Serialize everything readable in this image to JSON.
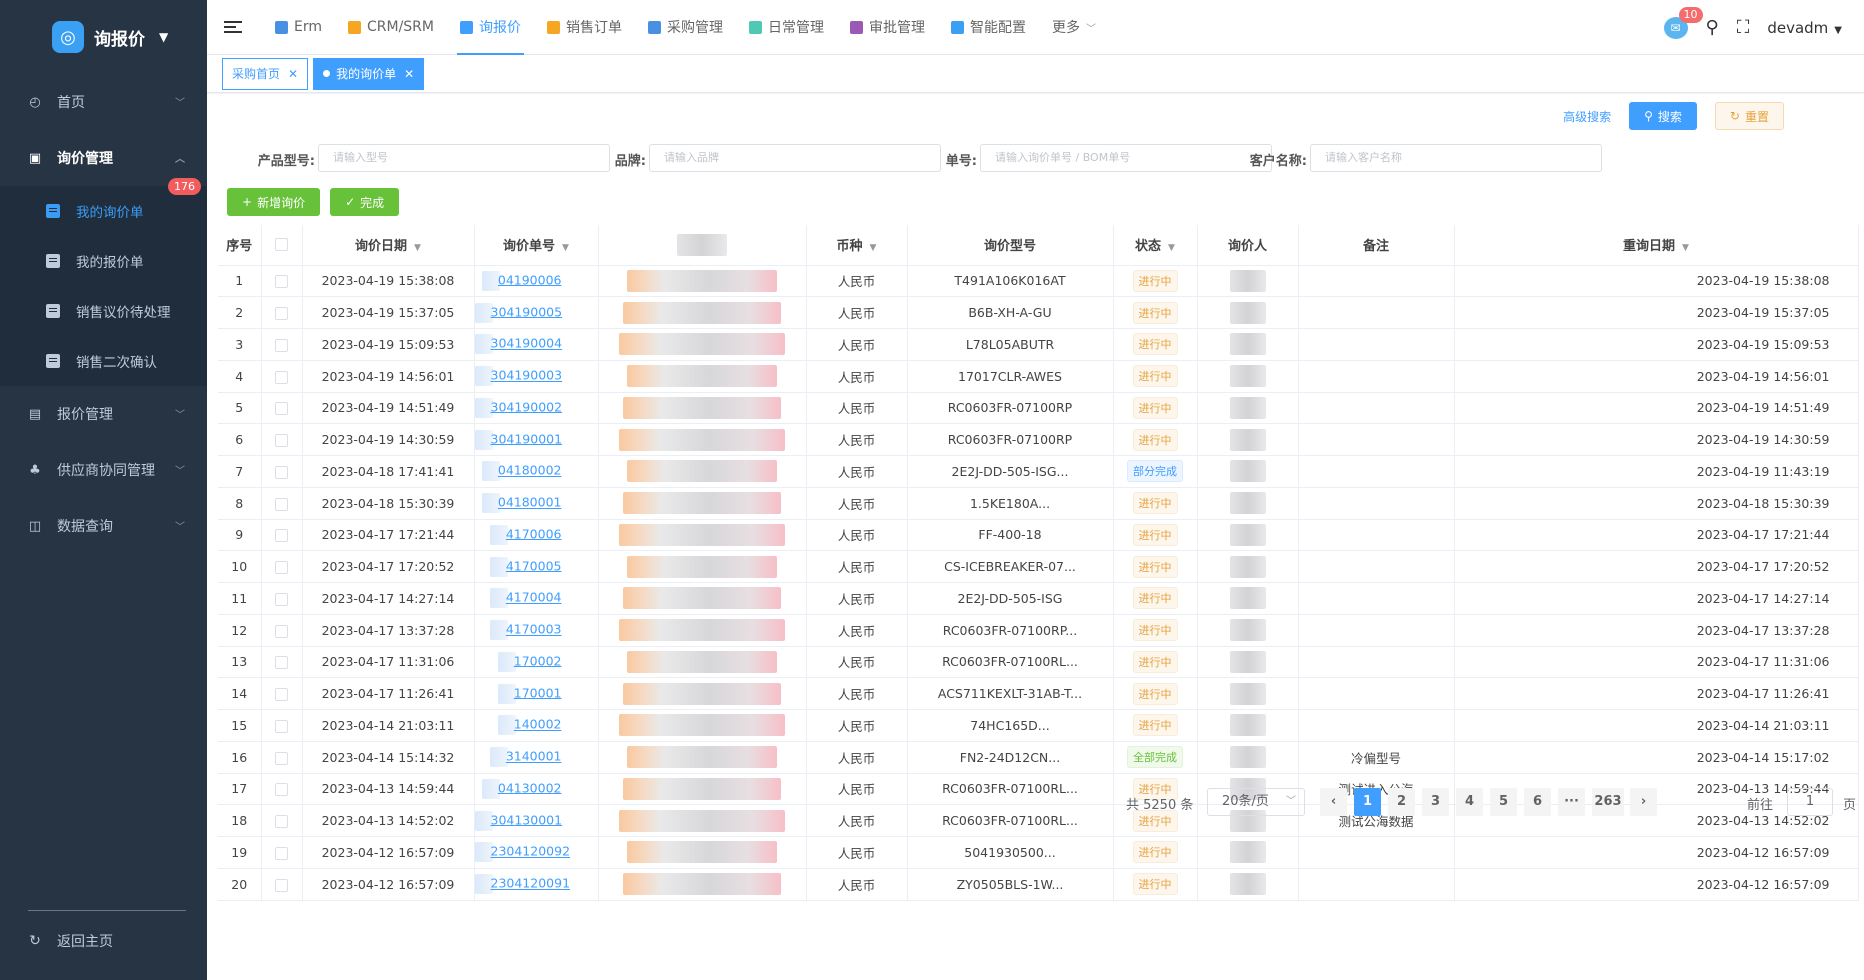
{
  "app": {
    "name": "询报价"
  },
  "sidebar": {
    "items": [
      {
        "label": "首页"
      },
      {
        "label": "询价管理"
      },
      {
        "label": "报价管理"
      },
      {
        "label": "供应商协同管理"
      },
      {
        "label": "数据查询"
      }
    ],
    "sub_items": [
      {
        "label": "我的询价单",
        "badge": "176"
      },
      {
        "label": "我的报价单"
      },
      {
        "label": "销售议价待处理"
      },
      {
        "label": "销售二次确认"
      }
    ],
    "back_home": "返回主页"
  },
  "topnav": {
    "tabs": [
      {
        "label": "Erm",
        "color": "#4a90e2"
      },
      {
        "label": "CRM/SRM",
        "color": "#f5a623"
      },
      {
        "label": "询报价",
        "color": "#409eff"
      },
      {
        "label": "销售订单",
        "color": "#f5a623"
      },
      {
        "label": "采购管理",
        "color": "#4a90e2"
      },
      {
        "label": "日常管理",
        "color": "#50c8b4"
      },
      {
        "label": "审批管理",
        "color": "#9b59b6"
      },
      {
        "label": "智能配置",
        "color": "#3aa0f3"
      }
    ],
    "more": "更多",
    "message_count": "10",
    "user": "devadm"
  },
  "page_tabs": [
    {
      "label": "采购首页"
    },
    {
      "label": "我的询价单"
    }
  ],
  "toolbar": {
    "advanced_search": "高级搜索",
    "search": "搜索",
    "reset": "重置",
    "add": "新增询价",
    "complete": "完成"
  },
  "filters": [
    {
      "label": "产品型号:",
      "placeholder": "请输入型号"
    },
    {
      "label": "品牌:",
      "placeholder": "请输入品牌"
    },
    {
      "label": "单号:",
      "placeholder": "请输入询价单号 / BOM单号"
    },
    {
      "label": "客户名称:",
      "placeholder": "请输入客户名称"
    }
  ],
  "table": {
    "headers": [
      "序号",
      "",
      "询价日期",
      "询价单号",
      "",
      "币种",
      "询价型号",
      "状态",
      "询价人",
      "备注",
      "重询日期"
    ],
    "rows": [
      {
        "no": "1",
        "date": "2023-04-19 15:38:08",
        "order": "04190006",
        "currency": "人民币",
        "model": "T491A106K016AT",
        "status": "进行中",
        "note": "",
        "redate": "2023-04-19 15:38:08"
      },
      {
        "no": "2",
        "date": "2023-04-19 15:37:05",
        "order": "304190005",
        "currency": "人民币",
        "model": "B6B-XH-A-GU",
        "status": "进行中",
        "note": "",
        "redate": "2023-04-19 15:37:05"
      },
      {
        "no": "3",
        "date": "2023-04-19 15:09:53",
        "order": "304190004",
        "currency": "人民币",
        "model": "L78L05ABUTR",
        "status": "进行中",
        "note": "",
        "redate": "2023-04-19 15:09:53"
      },
      {
        "no": "4",
        "date": "2023-04-19 14:56:01",
        "order": "304190003",
        "currency": "人民币",
        "model": "17017CLR-AWES",
        "status": "进行中",
        "note": "",
        "redate": "2023-04-19 14:56:01"
      },
      {
        "no": "5",
        "date": "2023-04-19 14:51:49",
        "order": "304190002",
        "currency": "人民币",
        "model": "RC0603FR-07100RP",
        "status": "进行中",
        "note": "",
        "redate": "2023-04-19 14:51:49"
      },
      {
        "no": "6",
        "date": "2023-04-19 14:30:59",
        "order": "304190001",
        "currency": "人民币",
        "model": "RC0603FR-07100RP",
        "status": "进行中",
        "note": "",
        "redate": "2023-04-19 14:30:59"
      },
      {
        "no": "7",
        "date": "2023-04-18 17:41:41",
        "order": "04180002",
        "currency": "人民币",
        "model": "2E2J-DD-505-ISG...",
        "status": "部分完成",
        "note": "",
        "redate": "2023-04-19 11:43:19"
      },
      {
        "no": "8",
        "date": "2023-04-18 15:30:39",
        "order": "04180001",
        "currency": "人民币",
        "model": "1.5KE180A...",
        "status": "进行中",
        "note": "",
        "redate": "2023-04-18 15:30:39"
      },
      {
        "no": "9",
        "date": "2023-04-17 17:21:44",
        "order": "4170006",
        "currency": "人民币",
        "model": "FF-400-18",
        "status": "进行中",
        "note": "",
        "redate": "2023-04-17 17:21:44"
      },
      {
        "no": "10",
        "date": "2023-04-17 17:20:52",
        "order": "4170005",
        "currency": "人民币",
        "model": "CS-ICEBREAKER-07...",
        "status": "进行中",
        "note": "",
        "redate": "2023-04-17 17:20:52"
      },
      {
        "no": "11",
        "date": "2023-04-17 14:27:14",
        "order": "4170004",
        "currency": "人民币",
        "model": "2E2J-DD-505-ISG",
        "status": "进行中",
        "note": "",
        "redate": "2023-04-17 14:27:14"
      },
      {
        "no": "12",
        "date": "2023-04-17 13:37:28",
        "order": "4170003",
        "currency": "人民币",
        "model": "RC0603FR-07100RP...",
        "status": "进行中",
        "note": "",
        "redate": "2023-04-17 13:37:28"
      },
      {
        "no": "13",
        "date": "2023-04-17 11:31:06",
        "order": "170002",
        "currency": "人民币",
        "model": "RC0603FR-07100RL...",
        "status": "进行中",
        "note": "",
        "redate": "2023-04-17 11:31:06"
      },
      {
        "no": "14",
        "date": "2023-04-17 11:26:41",
        "order": "170001",
        "currency": "人民币",
        "model": "ACS711KEXLT-31AB-T...",
        "status": "进行中",
        "note": "",
        "redate": "2023-04-17 11:26:41"
      },
      {
        "no": "15",
        "date": "2023-04-14 21:03:11",
        "order": "140002",
        "currency": "人民币",
        "model": "74HC165D...",
        "status": "进行中",
        "note": "",
        "redate": "2023-04-14 21:03:11"
      },
      {
        "no": "16",
        "date": "2023-04-14 15:14:32",
        "order": "3140001",
        "currency": "人民币",
        "model": "FN2-24D12CN...",
        "status": "全部完成",
        "note": "冷偏型号",
        "redate": "2023-04-14 15:17:02"
      },
      {
        "no": "17",
        "date": "2023-04-13 14:59:44",
        "order": "04130002",
        "currency": "人民币",
        "model": "RC0603FR-07100RL...",
        "status": "进行中",
        "note": "测试进入公海",
        "redate": "2023-04-13 14:59:44"
      },
      {
        "no": "18",
        "date": "2023-04-13 14:52:02",
        "order": "304130001",
        "currency": "人民币",
        "model": "RC0603FR-07100RL...",
        "status": "进行中",
        "note": "测试公海数据",
        "redate": "2023-04-13 14:52:02"
      },
      {
        "no": "19",
        "date": "2023-04-12 16:57:09",
        "order": "2304120092",
        "currency": "人民币",
        "model": "5041930500...",
        "status": "进行中",
        "note": "",
        "redate": "2023-04-12 16:57:09"
      },
      {
        "no": "20",
        "date": "2023-04-12 16:57:09",
        "order": "2304120091",
        "currency": "人民币",
        "model": "ZY0505BLS-1W...",
        "status": "进行中",
        "note": "",
        "redate": "2023-04-12 16:57:09"
      }
    ]
  },
  "pagination": {
    "total": "共 5250 条",
    "page_size": "20条/页",
    "pages": [
      "1",
      "2",
      "3",
      "4",
      "5",
      "6",
      "···",
      "263"
    ],
    "goto_label": "前往",
    "goto_value": "1",
    "page_suffix": "页"
  }
}
